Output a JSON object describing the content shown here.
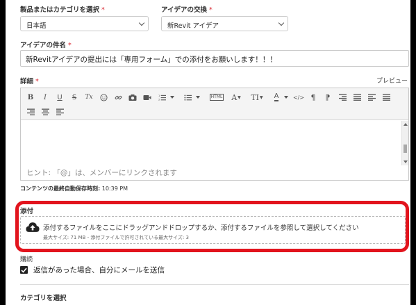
{
  "form": {
    "product_label": "製品またはカテゴリを選択",
    "product_value": "日本語",
    "exchange_label": "アイデアの交換",
    "exchange_value": "新Revit アイデア",
    "required_mark": "*",
    "subject_label": "アイデアの件名",
    "subject_value": "新Revitアイデアの提出には「専用フォーム」での添付をお願いします！！！",
    "details_label": "詳細",
    "preview_label": "プレビュー",
    "editor_hint": "ヒント: 「@」は、メンバーにリンクされます",
    "autosave_label": "コンテンツの最終自動保存時刻:",
    "autosave_time": "10:39 PM",
    "attach_label": "添付",
    "drop_text": "添付するファイルをここにドラッグアンドドロップするか、添付するファイルを参照して選択してください",
    "drop_limits": "最大サイズ: 71 MB - 添付ファイルで許可されている最大サイズ: 3",
    "subscribe_label": "購読",
    "subscribe_checkbox": "返信があった場合、自分にメールを送信",
    "subscribe_checked": true,
    "category_label": "カテゴリを選択"
  },
  "toolbar": {
    "icons": [
      "bold-icon",
      "italic-icon",
      "underline-icon",
      "strikethrough-icon",
      "clear-format-icon",
      "emoji-icon",
      "link-icon",
      "camera-icon",
      "video-icon",
      "ordered-list-icon",
      "ordered-list-dropdown",
      "unordered-list-icon",
      "unordered-list-dropdown",
      "html-icon",
      "font-icon",
      "font-size-icon",
      "text-color-icon",
      "code-icon",
      "paragraph-ltr-icon",
      "paragraph-rtl-icon",
      "table-icon",
      "align-justify-icon",
      "align-left-icon",
      "align-center-icon",
      "align-right-icon"
    ],
    "bold": "B",
    "italic": "I",
    "underline": "U",
    "strike": "S",
    "clear": "Tx",
    "html": "HTML",
    "font": "A",
    "fontsize": "TI",
    "color": "A",
    "code": "</>",
    "para": "¶",
    "para_rtl": "¶"
  },
  "colors": {
    "accent_red": "#e2141d",
    "required_red": "#d9232d"
  }
}
